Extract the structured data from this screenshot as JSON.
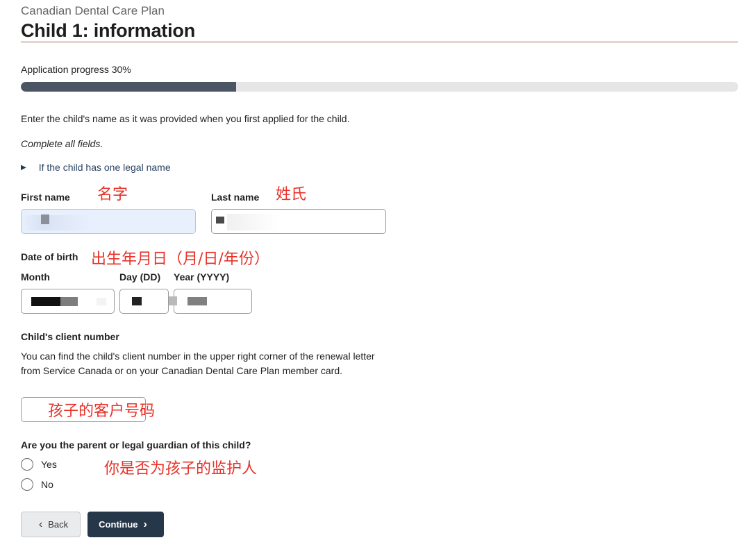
{
  "header": {
    "eyebrow": "Canadian Dental Care Plan",
    "title": "Child 1: information"
  },
  "progress": {
    "label": "Application progress 30%",
    "value": 0.3
  },
  "intro": "Enter the child's name as it was provided when you first applied for the child.",
  "required_note": "Complete all fields.",
  "details_toggle": "If the child has one legal name",
  "fields": {
    "first_name": {
      "label": "First name",
      "annotation": "名字"
    },
    "last_name": {
      "label": "Last name",
      "annotation": "姓氏"
    },
    "dob": {
      "label": "Date of birth",
      "annotation": "出生年月日（月/日/年份）",
      "month_label": "Month",
      "day_label": "Day (DD)",
      "year_label": "Year (YYYY)"
    },
    "client_number": {
      "label": "Child's client number",
      "help": "You can find the child's client number in the upper right corner of the renewal letter from Service Canada or on your Canadian Dental Care Plan member card.",
      "annotation": "孩子的客户号码"
    }
  },
  "guardian": {
    "question": "Are you the parent or legal guardian of this child?",
    "annotation": "你是否为孩子的监护人",
    "options": [
      "Yes",
      "No"
    ]
  },
  "buttons": {
    "back": "Back",
    "continue": "Continue"
  },
  "colors": {
    "primary": "#26374a",
    "progress_fill": "#4b5563",
    "annotation": "#e8322a",
    "rule": "#9e6a55"
  }
}
